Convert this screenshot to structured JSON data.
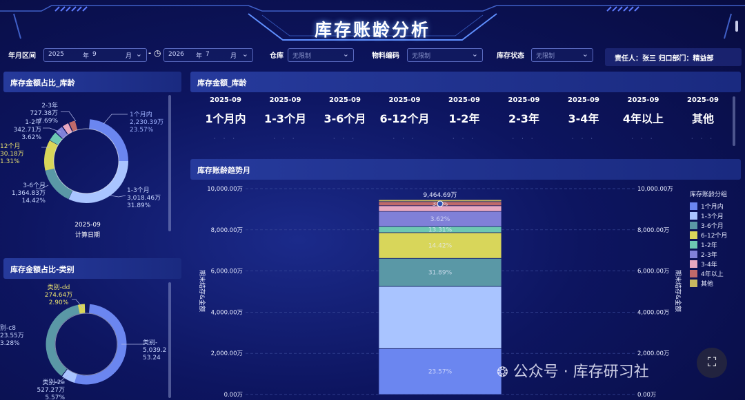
{
  "header": {
    "title": "库存账龄分析"
  },
  "filters": {
    "date_range_label": "年月区间",
    "start_year": "2025",
    "year_unit": "年",
    "start_month": "9",
    "month_unit": "月",
    "separator": "-",
    "end_year": "2026",
    "end_month": "7",
    "warehouse_label": "仓库",
    "warehouse_placeholder": "无限制",
    "material_label": "物料编码",
    "material_placeholder": "无限制",
    "status_label": "库存状态",
    "status_placeholder": "无限制",
    "responsible": "责任人：张三   归口部门：精益部"
  },
  "panels": {
    "age_ratio_title": "库存金额占比_库龄",
    "age_amount_title": "库存金额_库龄",
    "trend_title": "库存账龄趋势月",
    "category_ratio_title": "库存金额占比-类别"
  },
  "age_donut": {
    "date": "2025-09",
    "date_caption": "计算日期",
    "labels": [
      {
        "name": "1个月内",
        "value": "2,230.39万",
        "pct": "23.57%"
      },
      {
        "name": "1-3个月",
        "value": "3,018.46万",
        "pct": "31.89%"
      },
      {
        "name": "3-6个月",
        "value": "1,364.83万",
        "pct": "14.42%"
      },
      {
        "name": "12个月",
        "value": "30.18万",
        "pct": "1.31%"
      },
      {
        "name": "1-2年",
        "value": "342.71万",
        "pct": "3.62%"
      },
      {
        "name": "2-3年",
        "value": "727.38万",
        "pct": "7.69%"
      }
    ]
  },
  "age_columns": [
    {
      "date": "2025-09",
      "name": "1个月内"
    },
    {
      "date": "2025-09",
      "name": "1-3个月"
    },
    {
      "date": "2025-09",
      "name": "3-6个月"
    },
    {
      "date": "2025-09",
      "name": "6-12个月"
    },
    {
      "date": "2025-09",
      "name": "1-2年"
    },
    {
      "date": "2025-09",
      "name": "2-3年"
    },
    {
      "date": "2025-09",
      "name": "3-4年"
    },
    {
      "date": "2025-09",
      "name": "4年以上"
    },
    {
      "date": "2025-09",
      "name": "其他"
    }
  ],
  "age_dots": "· · ·",
  "category_donut": {
    "labels": [
      {
        "name": "类别-dd",
        "value": "274.64万",
        "pct": "2.90%"
      },
      {
        "name": "别-c8",
        "value": "23.55万",
        "pct": "3.28%"
      },
      {
        "name": "类别-2e",
        "value": "527.27万",
        "pct": "5.57%"
      },
      {
        "name": "类别-",
        "value": "5,039.2",
        "pct": "53.24"
      }
    ]
  },
  "chart_data": {
    "type": "bar",
    "stacked": true,
    "ylabel": "期末结存&金额",
    "ylim": [
      0,
      10000
    ],
    "yticks": [
      "0.00万",
      "2,000.00万",
      "4,000.00万",
      "6,000.00万",
      "8,000.00万",
      "10,000.00万"
    ],
    "total_label": "9,464.69万",
    "legend_title": "库存账龄分组",
    "series": [
      {
        "name": "1个月内",
        "value": 2230.39,
        "label": "23.57%",
        "color": "#6b86f0"
      },
      {
        "name": "1-3个月",
        "value": 3018.46,
        "label": "",
        "color": "#a9c4ff"
      },
      {
        "name": "3-6个月",
        "value": 1364.83,
        "label": "31.89%",
        "color": "#5a98a6"
      },
      {
        "name": "6-12个月",
        "value": 1250.0,
        "label": "14.42%",
        "color": "#d8d65a"
      },
      {
        "name": "1-2年",
        "value": 300.0,
        "label": "13.31%",
        "color": "#6dc8b2"
      },
      {
        "name": "2-3年",
        "value": 727.38,
        "label": "3.62%",
        "color": "#8080d8"
      },
      {
        "name": "3-4年",
        "value": 280.0,
        "label": "",
        "color": "#e8a8c0"
      },
      {
        "name": "4年以上",
        "value": 200.0,
        "label": "3.7%",
        "color": "#c06a6a"
      },
      {
        "name": "其他",
        "value": 93.63,
        "label": "",
        "color": "#c8b860"
      }
    ]
  },
  "watermark": "公众号 · 库存研习社"
}
